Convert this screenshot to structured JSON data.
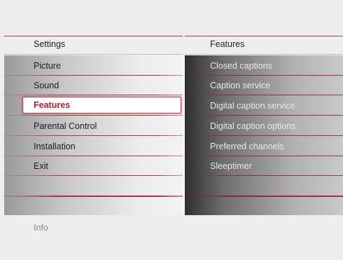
{
  "header": {
    "left_title": "Settings",
    "right_title": "Features"
  },
  "menu": {
    "items": [
      {
        "label": "Picture"
      },
      {
        "label": "Sound"
      },
      {
        "label": "Features",
        "selected": true
      },
      {
        "label": "Parental Control"
      },
      {
        "label": "Installation"
      },
      {
        "label": "Exit"
      }
    ]
  },
  "submenu": {
    "items": [
      {
        "label": "Closed captions"
      },
      {
        "label": "Caption service"
      },
      {
        "label": "Digital caption service"
      },
      {
        "label": "Digital caption options"
      },
      {
        "label": "Preferred channels"
      },
      {
        "label": "Sleeptimer"
      }
    ]
  },
  "footer": {
    "info_label": "Info"
  },
  "colors": {
    "accent": "#b01e2c",
    "separator": "#b0303a"
  }
}
